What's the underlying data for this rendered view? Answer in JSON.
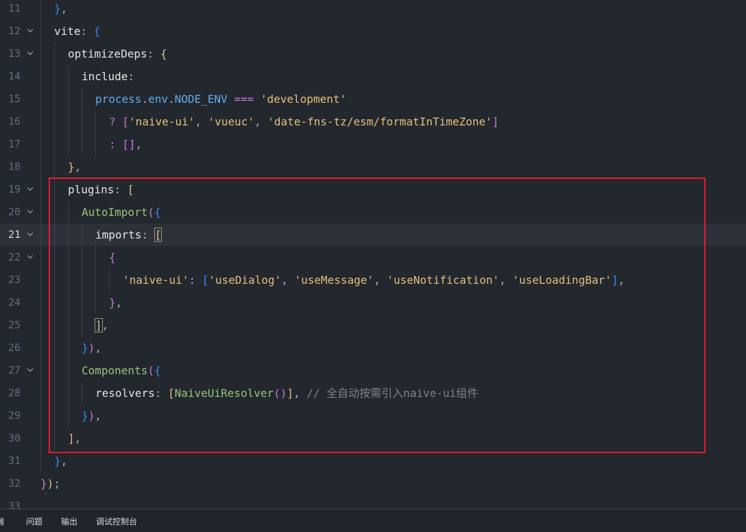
{
  "editor": {
    "active_line": "21",
    "lines": [
      {
        "num": "11",
        "fold": false,
        "indent": 1,
        "tokens": [
          {
            "t": "}",
            "c": "t-b3"
          },
          {
            "t": ",",
            "c": "t-punc"
          }
        ]
      },
      {
        "num": "12",
        "fold": true,
        "indent": 1,
        "tokens": [
          {
            "t": "vite",
            "c": "t-prop"
          },
          {
            "t": ": ",
            "c": "t-punc"
          },
          {
            "t": "{",
            "c": "t-b3"
          }
        ]
      },
      {
        "num": "13",
        "fold": true,
        "indent": 2,
        "tokens": [
          {
            "t": "optimizeDeps",
            "c": "t-prop"
          },
          {
            "t": ": ",
            "c": "t-punc"
          },
          {
            "t": "{",
            "c": "t-b1"
          }
        ]
      },
      {
        "num": "14",
        "fold": false,
        "indent": 3,
        "tokens": [
          {
            "t": "include",
            "c": "t-prop"
          },
          {
            "t": ":",
            "c": "t-punc"
          }
        ]
      },
      {
        "num": "15",
        "fold": false,
        "indent": 4,
        "tokens": [
          {
            "t": "process",
            "c": "t-blue"
          },
          {
            "t": ".",
            "c": "t-punc"
          },
          {
            "t": "env",
            "c": "t-blue"
          },
          {
            "t": ".",
            "c": "t-punc"
          },
          {
            "t": "NODE_ENV",
            "c": "t-blue"
          },
          {
            "t": " ",
            "c": "t-punc"
          },
          {
            "t": "===",
            "c": "t-op"
          },
          {
            "t": " ",
            "c": "t-punc"
          },
          {
            "t": "'development'",
            "c": "t-str"
          }
        ]
      },
      {
        "num": "16",
        "fold": false,
        "indent": 5,
        "tokens": [
          {
            "t": "?",
            "c": "t-op"
          },
          {
            "t": " ",
            "c": "t-punc"
          },
          {
            "t": "[",
            "c": "t-b2"
          },
          {
            "t": "'naive-ui'",
            "c": "t-str"
          },
          {
            "t": ", ",
            "c": "t-punc"
          },
          {
            "t": "'vueuc'",
            "c": "t-str"
          },
          {
            "t": ", ",
            "c": "t-punc"
          },
          {
            "t": "'date-fns-tz/esm/formatInTimeZone'",
            "c": "t-str"
          },
          {
            "t": "]",
            "c": "t-b2"
          }
        ]
      },
      {
        "num": "17",
        "fold": false,
        "indent": 5,
        "tokens": [
          {
            "t": ":",
            "c": "t-op"
          },
          {
            "t": " ",
            "c": "t-punc"
          },
          {
            "t": "[]",
            "c": "t-b2"
          },
          {
            "t": ",",
            "c": "t-punc"
          }
        ]
      },
      {
        "num": "18",
        "fold": false,
        "indent": 2,
        "tokens": [
          {
            "t": "}",
            "c": "t-b1"
          },
          {
            "t": ",",
            "c": "t-punc"
          }
        ]
      },
      {
        "num": "19",
        "fold": true,
        "indent": 2,
        "tokens": [
          {
            "t": "plugins",
            "c": "t-prop"
          },
          {
            "t": ": ",
            "c": "t-punc"
          },
          {
            "t": "[",
            "c": "t-b1"
          }
        ]
      },
      {
        "num": "20",
        "fold": true,
        "indent": 3,
        "tokens": [
          {
            "t": "AutoImport",
            "c": "t-fn"
          },
          {
            "t": "(",
            "c": "t-b2"
          },
          {
            "t": "{",
            "c": "t-b3"
          }
        ]
      },
      {
        "num": "21",
        "fold": true,
        "indent": 4,
        "tokens": [
          {
            "t": "imports",
            "c": "t-prop"
          },
          {
            "t": ": ",
            "c": "t-punc"
          },
          {
            "t": "[",
            "c": "t-b1 bm"
          }
        ]
      },
      {
        "num": "22",
        "fold": true,
        "indent": 5,
        "tokens": [
          {
            "t": "{",
            "c": "t-b2"
          }
        ]
      },
      {
        "num": "23",
        "fold": false,
        "indent": 6,
        "tokens": [
          {
            "t": "'naive-ui'",
            "c": "t-str"
          },
          {
            "t": ": ",
            "c": "t-punc"
          },
          {
            "t": "[",
            "c": "t-b3"
          },
          {
            "t": "'useDialog'",
            "c": "t-str"
          },
          {
            "t": ", ",
            "c": "t-punc"
          },
          {
            "t": "'useMessage'",
            "c": "t-str"
          },
          {
            "t": ", ",
            "c": "t-punc"
          },
          {
            "t": "'useNotification'",
            "c": "t-str"
          },
          {
            "t": ", ",
            "c": "t-punc"
          },
          {
            "t": "'useLoadingBar'",
            "c": "t-str"
          },
          {
            "t": "]",
            "c": "t-b3"
          },
          {
            "t": ",",
            "c": "t-punc"
          }
        ]
      },
      {
        "num": "24",
        "fold": false,
        "indent": 5,
        "tokens": [
          {
            "t": "}",
            "c": "t-b2"
          },
          {
            "t": ",",
            "c": "t-punc"
          }
        ]
      },
      {
        "num": "25",
        "fold": false,
        "indent": 4,
        "tokens": [
          {
            "t": "]",
            "c": "t-b1 bm"
          },
          {
            "t": ",",
            "c": "t-punc"
          }
        ]
      },
      {
        "num": "26",
        "fold": false,
        "indent": 3,
        "tokens": [
          {
            "t": "}",
            "c": "t-b3"
          },
          {
            "t": ")",
            "c": "t-b2"
          },
          {
            "t": ",",
            "c": "t-punc"
          }
        ]
      },
      {
        "num": "27",
        "fold": true,
        "indent": 3,
        "tokens": [
          {
            "t": "Components",
            "c": "t-fn"
          },
          {
            "t": "(",
            "c": "t-b2"
          },
          {
            "t": "{",
            "c": "t-b3"
          }
        ]
      },
      {
        "num": "28",
        "fold": false,
        "indent": 4,
        "tokens": [
          {
            "t": "resolvers",
            "c": "t-prop"
          },
          {
            "t": ": ",
            "c": "t-punc"
          },
          {
            "t": "[",
            "c": "t-b1"
          },
          {
            "t": "NaiveUiResolver",
            "c": "t-fn"
          },
          {
            "t": "()",
            "c": "t-b2"
          },
          {
            "t": "]",
            "c": "t-b1"
          },
          {
            "t": ", ",
            "c": "t-punc"
          },
          {
            "t": "// 全自动按需引入naive-ui组件",
            "c": "t-cmt"
          }
        ]
      },
      {
        "num": "29",
        "fold": false,
        "indent": 3,
        "tokens": [
          {
            "t": "}",
            "c": "t-b3"
          },
          {
            "t": ")",
            "c": "t-b2"
          },
          {
            "t": ",",
            "c": "t-punc"
          }
        ]
      },
      {
        "num": "30",
        "fold": false,
        "indent": 2,
        "tokens": [
          {
            "t": "]",
            "c": "t-b1"
          },
          {
            "t": ",",
            "c": "t-punc"
          }
        ]
      },
      {
        "num": "31",
        "fold": false,
        "indent": 1,
        "tokens": [
          {
            "t": "}",
            "c": "t-b3"
          },
          {
            "t": ",",
            "c": "t-punc"
          }
        ]
      },
      {
        "num": "32",
        "fold": false,
        "indent": 0,
        "tokens": [
          {
            "t": "}",
            "c": "t-b2"
          },
          {
            "t": ")",
            "c": "t-b1"
          },
          {
            "t": ";",
            "c": "t-punc"
          }
        ]
      },
      {
        "num": "33",
        "fold": false,
        "indent": 0,
        "tokens": []
      }
    ]
  },
  "panel": {
    "tabs": [
      {
        "label": "端"
      },
      {
        "label": "问题"
      },
      {
        "label": "输出"
      },
      {
        "label": "调试控制台"
      }
    ]
  }
}
